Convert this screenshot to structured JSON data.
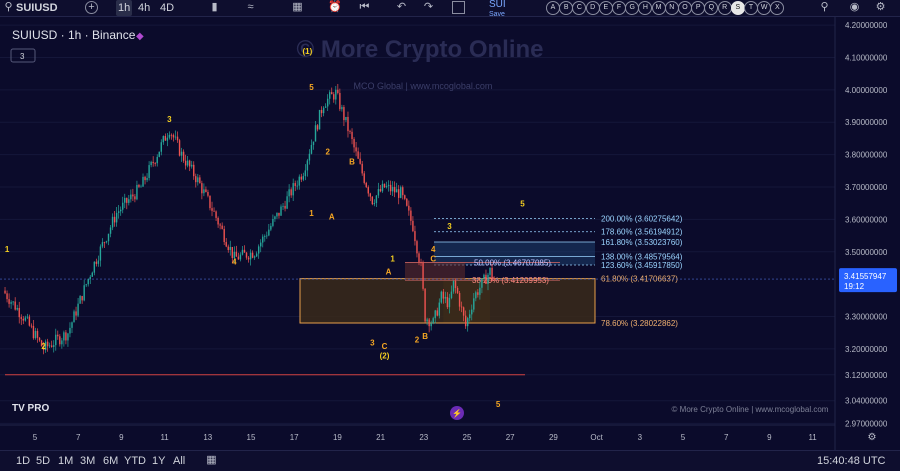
{
  "toolbar": {
    "symbol": "SUIUSD",
    "timeframes": [
      "1h",
      "4h",
      "4D"
    ],
    "active_timeframe": "1h",
    "compare_symbol": "SUI",
    "compare_sub": "Save",
    "letters": [
      "A",
      "B",
      "C",
      "D",
      "E",
      "F",
      "G",
      "H",
      "M",
      "N",
      "O",
      "P",
      "Q",
      "R",
      "S",
      "T",
      "W",
      "X"
    ],
    "active_letter": "S"
  },
  "legend": {
    "title": "SUIUSD · 1h · Binance",
    "badge": "3"
  },
  "watermark": {
    "main": "© More Crypto Online",
    "sub": "MCO Global  |  www.mcoglobal.com",
    "footer": "© More Crypto Online  |  www.mcoglobal.com"
  },
  "logo_text": "TV PRO",
  "colors": {
    "background": "#0b0b2b",
    "up": "#26a69a",
    "down": "#ef5350",
    "label_orange": "#f5a623",
    "label_yellow": "#f5d020",
    "fib_blue": "#9ad4ff",
    "zone_fill": "#3a2a1a",
    "zone_border": "#e8a04a",
    "last_price_bg": "#2962ff"
  },
  "chart_data": {
    "type": "candlestick",
    "title": "SUIUSD · 1h · Binance",
    "x_tick_labels": [
      "5",
      "7",
      "9",
      "11",
      "13",
      "15",
      "17",
      "19",
      "21",
      "23",
      "25",
      "27",
      "29",
      "Oct",
      "3",
      "5",
      "7",
      "9",
      "11"
    ],
    "y_tick_labels": [
      "4.20000000",
      "4.10000000",
      "4.00000000",
      "3.90000000",
      "3.80000000",
      "3.70000000",
      "3.60000000",
      "3.50000000",
      "3.30000000",
      "3.20000000",
      "3.12000000",
      "3.04000000",
      "2.97000000"
    ],
    "ylim": [
      2.965,
      4.225
    ],
    "last_price": {
      "value": "3.41557947",
      "countdown": "19:12"
    },
    "price_path": [
      [
        0,
        3.38
      ],
      [
        5,
        3.3
      ],
      [
        10,
        3.2
      ],
      [
        16,
        3.25
      ],
      [
        22,
        3.45
      ],
      [
        28,
        3.62
      ],
      [
        34,
        3.7
      ],
      [
        41,
        3.88
      ],
      [
        44,
        3.8
      ],
      [
        48,
        3.72
      ],
      [
        52,
        3.62
      ],
      [
        57,
        3.48
      ],
      [
        62,
        3.5
      ],
      [
        68,
        3.62
      ],
      [
        74,
        3.75
      ],
      [
        79,
        3.96
      ],
      [
        82,
        3.99
      ],
      [
        85,
        3.88
      ],
      [
        88,
        3.76
      ],
      [
        91,
        3.66
      ],
      [
        94,
        3.7
      ],
      [
        98,
        3.68
      ],
      [
        101,
        3.58
      ],
      [
        103,
        3.45
      ],
      [
        104,
        3.3
      ],
      [
        106,
        3.28
      ],
      [
        108,
        3.36
      ],
      [
        110,
        3.34
      ],
      [
        111,
        3.4
      ],
      [
        112,
        3.37
      ],
      [
        114,
        3.27
      ],
      [
        116,
        3.36
      ],
      [
        118,
        3.4
      ],
      [
        120,
        3.44
      ],
      [
        121,
        3.415
      ]
    ],
    "fib_levels": [
      {
        "label": "200.00% (3.60275642)",
        "value": 3.6028,
        "style": "dotted"
      },
      {
        "label": "178.60% (3.56194912)",
        "value": 3.5619,
        "style": "dotted"
      },
      {
        "label": "161.80% (3.53023760)",
        "value": 3.5302,
        "style": "solid"
      },
      {
        "label": "138.00% (3.48579564)",
        "value": 3.4858,
        "style": "solid"
      },
      {
        "label": "123.60% (3.45917850)",
        "value": 3.4592,
        "style": "dotted"
      }
    ],
    "retracement_labels": [
      {
        "label": "50.00% (3.46707085)",
        "value": 3.467
      },
      {
        "label": "38.20% (3.41209953)",
        "value": 3.4121
      }
    ],
    "zone": {
      "top_label": "61.80% (3.41706637)",
      "top": 3.417,
      "bottom_label": "78.60% (3.28022862)",
      "bottom": 3.28
    },
    "horizontal_line": 3.12,
    "wave_labels": [
      {
        "text": "1",
        "x": 1,
        "y": 3.5,
        "color": "yellow"
      },
      {
        "text": "2",
        "x": 10,
        "y": 3.2,
        "color": "yellow"
      },
      {
        "text": "3",
        "x": 41,
        "y": 3.9,
        "color": "yellow"
      },
      {
        "text": "4",
        "x": 57,
        "y": 3.46,
        "color": "orange"
      },
      {
        "text": "(1)",
        "x": 75,
        "y": 4.11,
        "color": "yellow"
      },
      {
        "text": "5",
        "x": 76,
        "y": 4.0,
        "color": "orange"
      },
      {
        "text": "2",
        "x": 80,
        "y": 3.8,
        "color": "orange"
      },
      {
        "text": "1",
        "x": 76,
        "y": 3.61,
        "color": "orange"
      },
      {
        "text": "B",
        "x": 86,
        "y": 3.77,
        "color": "orange"
      },
      {
        "text": "A",
        "x": 81,
        "y": 3.6,
        "color": "orange"
      },
      {
        "text": "3",
        "x": 91,
        "y": 3.21,
        "color": "orange"
      },
      {
        "text": "C",
        "x": 94,
        "y": 3.2,
        "color": "orange"
      },
      {
        "text": "(2)",
        "x": 94,
        "y": 3.17,
        "color": "yellow"
      },
      {
        "text": "A",
        "x": 95,
        "y": 3.43,
        "color": "orange"
      },
      {
        "text": "1",
        "x": 96,
        "y": 3.47,
        "color": "yellow"
      },
      {
        "text": "2",
        "x": 102,
        "y": 3.22,
        "color": "orange"
      },
      {
        "text": "B",
        "x": 104,
        "y": 3.23,
        "color": "orange"
      },
      {
        "text": "C",
        "x": 106,
        "y": 3.47,
        "color": "orange"
      },
      {
        "text": "4",
        "x": 106,
        "y": 3.5,
        "color": "orange"
      },
      {
        "text": "3",
        "x": 110,
        "y": 3.57,
        "color": "yellow"
      },
      {
        "text": "5",
        "x": 128,
        "y": 3.64,
        "color": "yellow"
      },
      {
        "text": "5",
        "x": 122,
        "y": 3.02,
        "color": "orange"
      }
    ]
  },
  "bottombar": {
    "ranges": [
      "1D",
      "5D",
      "1M",
      "3M",
      "6M",
      "YTD",
      "1Y",
      "All"
    ],
    "time": "15:40:48 UTC"
  }
}
